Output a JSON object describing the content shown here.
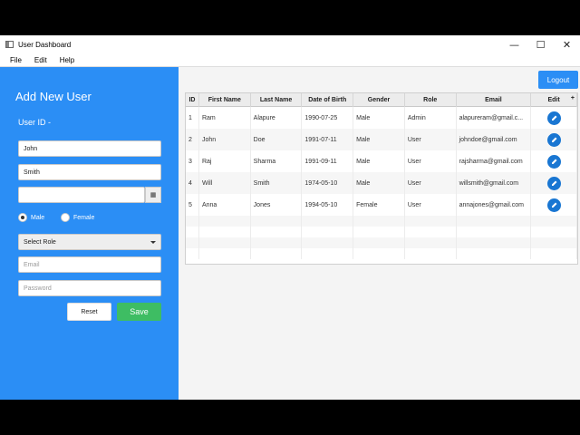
{
  "window": {
    "title": "User Dashboard",
    "minimize": "—",
    "maximize": "☐",
    "close": "✕"
  },
  "menu": {
    "file": "File",
    "edit": "Edit",
    "help": "Help"
  },
  "form": {
    "title": "Add New User",
    "user_id_label": "User ID -",
    "first_name": "John",
    "last_name": "Smith",
    "date_value": "",
    "gender_male": "Male",
    "gender_female": "Female",
    "role_select": "Select Role",
    "email_placeholder": "Email",
    "password_placeholder": "Password",
    "reset_label": "Reset",
    "save_label": "Save"
  },
  "logout_label": "Logout",
  "table": {
    "headers": [
      "ID",
      "First Name",
      "Last Name",
      "Date of Birth",
      "Gender",
      "Role",
      "Email",
      "Edit"
    ],
    "rows": [
      [
        "1",
        "Ram",
        "Alapure",
        "1990-07-25",
        "Male",
        "Admin",
        "alapureram@gmail.c..."
      ],
      [
        "2",
        "John",
        "Doe",
        "1991-07-11",
        "Male",
        "User",
        "johndoe@gmail.com"
      ],
      [
        "3",
        "Raj",
        "Sharma",
        "1991-09-11",
        "Male",
        "User",
        "rajsharma@gmail.com"
      ],
      [
        "4",
        "Will",
        "Smith",
        "1974-05-10",
        "Male",
        "User",
        "willsmith@gmail.com"
      ],
      [
        "5",
        "Anna",
        "Jones",
        "1994-05-10",
        "Female",
        "User",
        "annajones@gmail.com"
      ]
    ]
  },
  "colors": {
    "accent": "#2b8ef5",
    "save": "#3ebd63",
    "edit": "#1976d2"
  }
}
